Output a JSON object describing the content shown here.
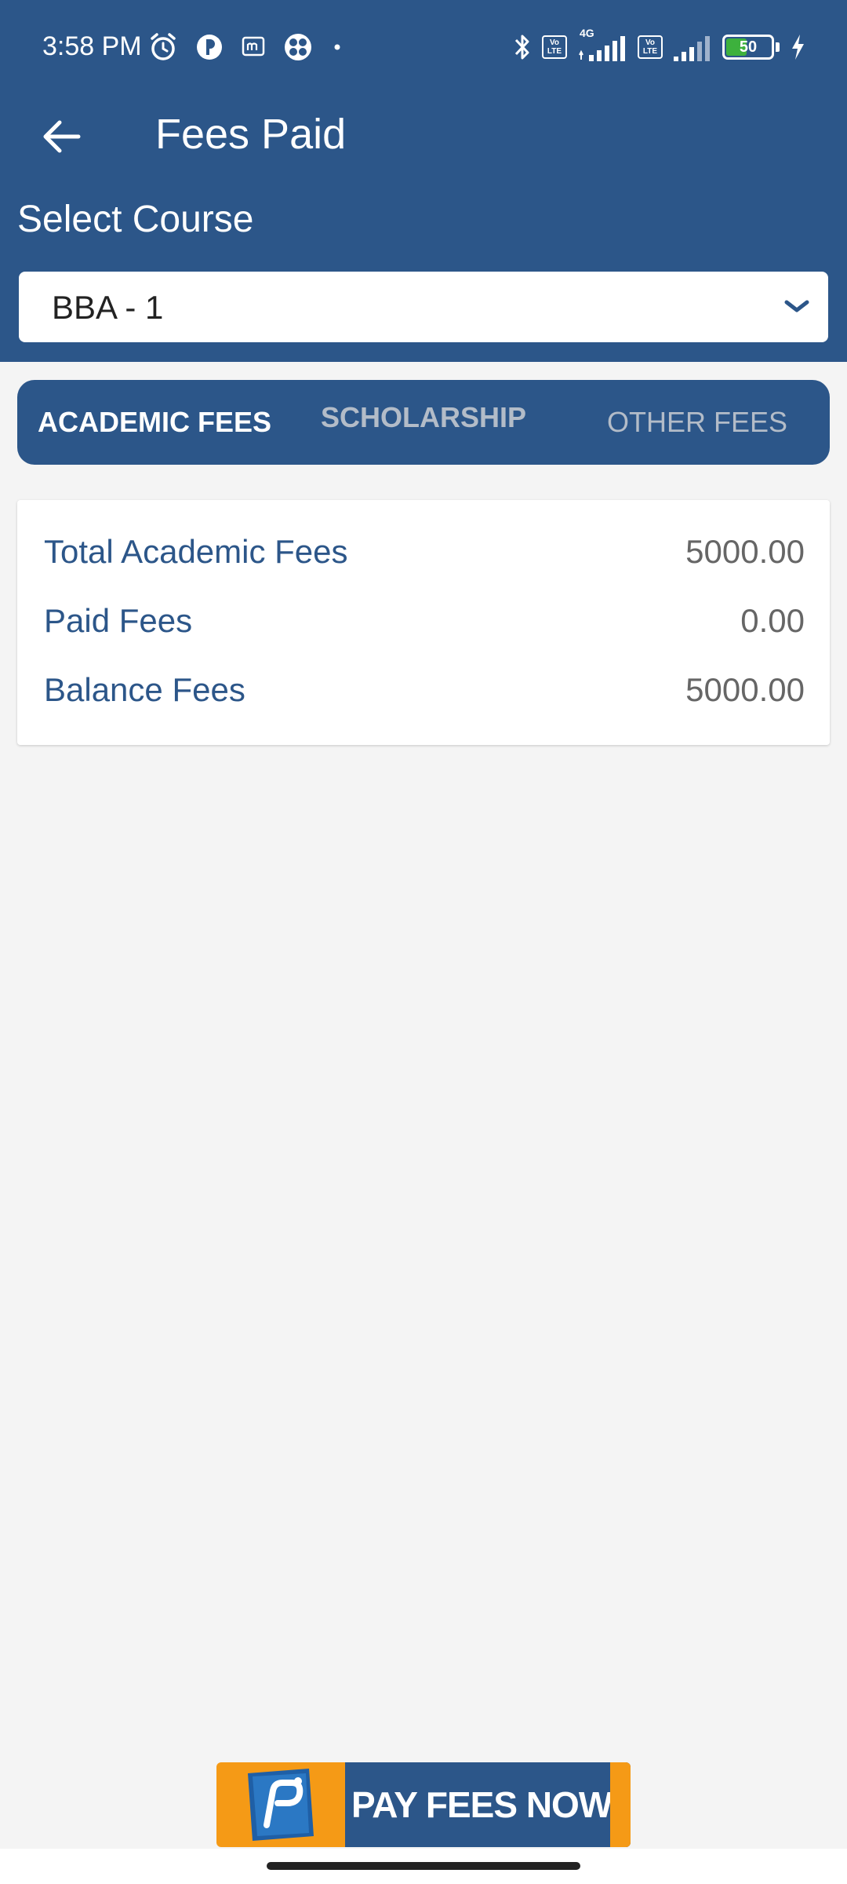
{
  "status_bar": {
    "time": "3:58 PM",
    "network": "4G",
    "volte_label_top": "Vo",
    "volte_label_bottom": "LTE",
    "battery": "50",
    "icons_left": [
      "alarm-icon",
      "app-notification-icon",
      "messaging-icon",
      "app-icon",
      "more-dot-icon"
    ],
    "icons_right": [
      "bluetooth-icon",
      "volte-icon",
      "signal-icon",
      "volte-icon",
      "signal-icon",
      "battery-icon",
      "charging-icon"
    ]
  },
  "app_bar": {
    "title": "Fees Paid",
    "back_icon": "back-arrow-icon"
  },
  "course": {
    "label": "Select Course",
    "selected": "BBA - 1"
  },
  "tabs": [
    {
      "label": "ACADEMIC FEES",
      "active": true
    },
    {
      "label": "SCHOLARSHIP",
      "active": false
    },
    {
      "label": "OTHER FEES",
      "active": false
    }
  ],
  "fees": [
    {
      "label": "Total Academic Fees",
      "value": "5000.00"
    },
    {
      "label": "Paid Fees",
      "value": "0.00"
    },
    {
      "label": "Balance Fees",
      "value": "5000.00"
    }
  ],
  "pay_button": {
    "label": "PAY FEES NOW"
  },
  "colors": {
    "primary": "#2c5689",
    "accent": "#f59a16",
    "background": "#f4f4f4",
    "battery_green": "#3db13d"
  }
}
